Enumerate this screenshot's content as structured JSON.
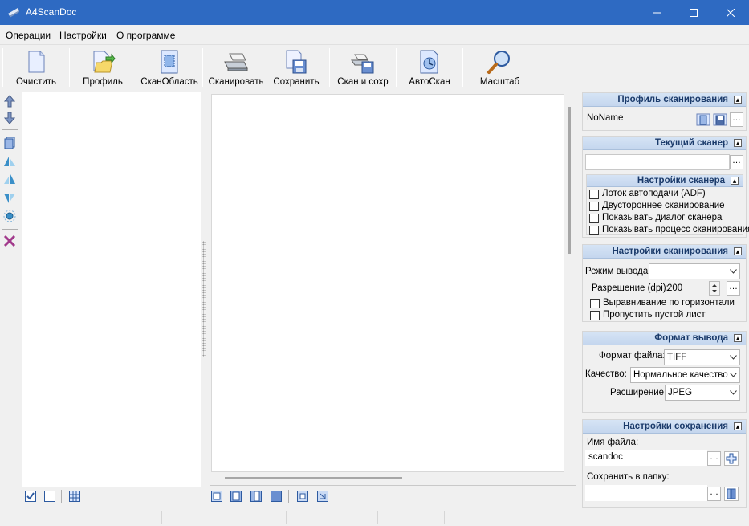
{
  "window": {
    "title": "A4ScanDoc"
  },
  "menu": {
    "items": [
      "Операции",
      "Настройки",
      "О программе"
    ]
  },
  "toolbar": {
    "buttons": [
      {
        "label": "Очистить",
        "icon": "blank-page-icon"
      },
      {
        "label": "Профиль",
        "icon": "profile-folder-icon"
      },
      {
        "label": "СканОбласть",
        "icon": "scan-area-icon"
      },
      {
        "label": "Сканировать",
        "icon": "scanner-icon"
      },
      {
        "label": "Сохранить",
        "icon": "save-document-icon"
      },
      {
        "label": "Скан и сохр",
        "icon": "scan-and-save-icon"
      },
      {
        "label": "АвтоСкан",
        "icon": "auto-scan-icon"
      },
      {
        "label": "Масштаб",
        "icon": "magnifier-icon"
      }
    ]
  },
  "panel": {
    "profile": {
      "title": "Профиль сканирования",
      "name": "NoName"
    },
    "scanner": {
      "title": "Текущий сканер",
      "value": "",
      "settings_title": "Настройки сканера",
      "checks": [
        {
          "label": "Лоток автоподачи (ADF)",
          "checked": false
        },
        {
          "label": "Двустороннее сканирование",
          "checked": false
        },
        {
          "label": "Показывать диалог сканера",
          "checked": false
        },
        {
          "label": "Показывать процесс сканирования",
          "checked": false
        }
      ]
    },
    "scan_settings": {
      "title": "Настройки сканирования",
      "mode_label": "Режим вывода:",
      "mode_value": "",
      "dpi_label": "Разрешение (dpi):",
      "dpi_value": "200",
      "checks": [
        {
          "label": "Выравнивание по горизонтали",
          "checked": false
        },
        {
          "label": "Пропустить пустой лист",
          "checked": false
        }
      ]
    },
    "output": {
      "title": "Формат вывода",
      "format_label": "Формат файла:",
      "format_value": "TIFF",
      "quality_label": "Качество:",
      "quality_value": "Нормальное качество",
      "ext_label": "Расширение:",
      "ext_value": "JPEG"
    },
    "save": {
      "title": "Настройки сохранения",
      "filename_label": "Имя файла:",
      "filename_value": "scandoc",
      "folder_label": "Сохранить в папку:",
      "folder_value": ""
    }
  },
  "colors": {
    "titlebar": "#2e6ac2",
    "group_header": "#c4d6ee",
    "group_title": "#1a3a6a"
  }
}
